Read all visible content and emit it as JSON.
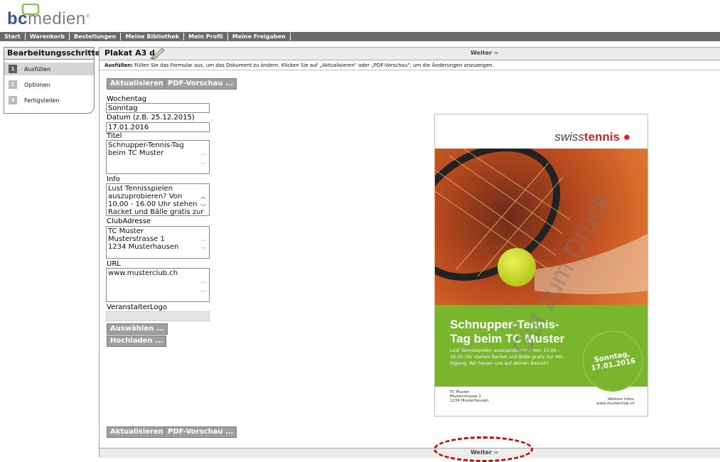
{
  "logo": {
    "brand_bc": "bc",
    "brand_rest": "medien",
    "registered": "®"
  },
  "nav": [
    "Start",
    "Warenkorb",
    "Bestellungen",
    "Meine Bibliothek",
    "Mein Profil",
    "Meine Freigaben"
  ],
  "steps": {
    "title": "Bearbeitungsschritte",
    "items": [
      {
        "num": "1",
        "label": "Ausfüllen"
      },
      {
        "num": "2",
        "label": "Optionen"
      },
      {
        "num": "3",
        "label": "Fertigstellen"
      }
    ]
  },
  "document": {
    "title": "Plakat A3 d",
    "next_label": "Weiter",
    "hint_bold": "Ausfüllen:",
    "hint_text": " Füllen Sie das Formular aus, um das Dokument zu ändern. Klicken Sie auf „Aktualisieren\" oder „PDF-Vorschau\", um die Änderungen anzuzeigen."
  },
  "buttons": {
    "refresh": "Aktualisieren",
    "pdf_preview": "PDF-Vorschau ...",
    "select": "Auswählen ...",
    "upload": "Hochladen ..."
  },
  "form": {
    "wochentag_label": "Wochentag",
    "wochentag_value": "Sonntag",
    "datum_label": "Datum (z.B. 25.12.2015)",
    "datum_value": "17.01.2016",
    "titel_label": "Titel",
    "titel_lines": [
      "Schnupper-Tennis-Tag",
      "beim TC Muster"
    ],
    "info_label": "Info",
    "info_lines": [
      "Lust Tennisspielen",
      "auszuprobieren? Von",
      "10.00 - 16.00 Uhr stehen",
      "Racket und Bälle gratis zur"
    ],
    "club_label": "ClubAdresse",
    "club_lines": [
      "TC Muster",
      "Musterstrasse 1",
      "1234 Musterhausen"
    ],
    "url_label": "URL",
    "url_value": "www.musterclub.ch",
    "logo_label": "VeranstalterLogo"
  },
  "poster": {
    "brand_light": "swiss",
    "brand_bold": "tennis",
    "headline_1": "Schnupper-Tennis-",
    "headline_2": "Tag beim TC Muster",
    "text_1": "Lust Tennisspielen auszuprobieren? Von 10.00 -",
    "text_2": "16.00 Uhr stehen Racket und Bälle gratis zur Ver-",
    "text_3": "fügung. Wir freuen uns auf deinen Besuch!",
    "date_day": "Sonntag,",
    "date_value": "17.01.2016",
    "club_1": "TC Muster",
    "club_2": "Musterstrasse 1",
    "club_3": "1234 Musterhausen",
    "info_1": "Weitere Infos:",
    "info_2": "www.musterclub.ch",
    "watermark": "Gut zum Druck"
  },
  "colors": {
    "nav_bg": "#6a6a6a",
    "button_bg": "#9f9f9f",
    "poster_green": "#7ab52e",
    "annotation": "#d40000"
  }
}
